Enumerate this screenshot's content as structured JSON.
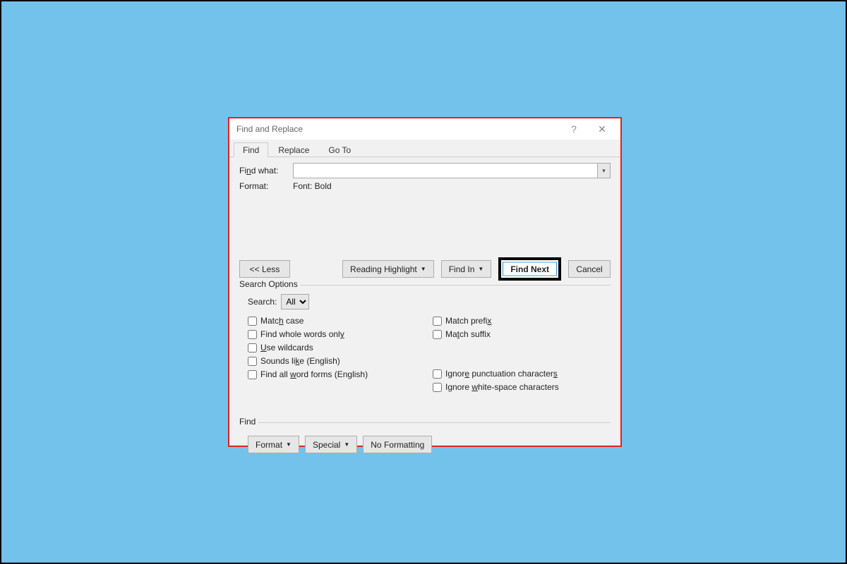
{
  "dialog": {
    "title": "Find and Replace",
    "help_icon": "?",
    "close_icon": "✕"
  },
  "tabs": {
    "find": "Find",
    "replace": "Replace",
    "goto": "Go To"
  },
  "find": {
    "find_what_label": "Find what:",
    "find_what_value": "",
    "format_label": "Format:",
    "format_value": "Font: Bold"
  },
  "buttons": {
    "less": "<<  Less",
    "reading_highlight": "Reading Highlight",
    "find_in": "Find In",
    "find_next": "Find Next",
    "cancel": "Cancel"
  },
  "search_options": {
    "legend": "Search Options",
    "search_label": "Search:",
    "search_value": "All",
    "match_case": "Match case",
    "whole_words": "Find whole words only",
    "wildcards": "Use wildcards",
    "sounds_like": "Sounds like (English)",
    "word_forms": "Find all word forms (English)",
    "match_prefix": "Match prefix",
    "match_suffix": "Match suffix",
    "ignore_punct": "Ignore punctuation characters",
    "ignore_white": "Ignore white-space characters"
  },
  "find_section": {
    "legend": "Find",
    "format": "Format",
    "special": "Special",
    "no_formatting": "No Formatting"
  }
}
